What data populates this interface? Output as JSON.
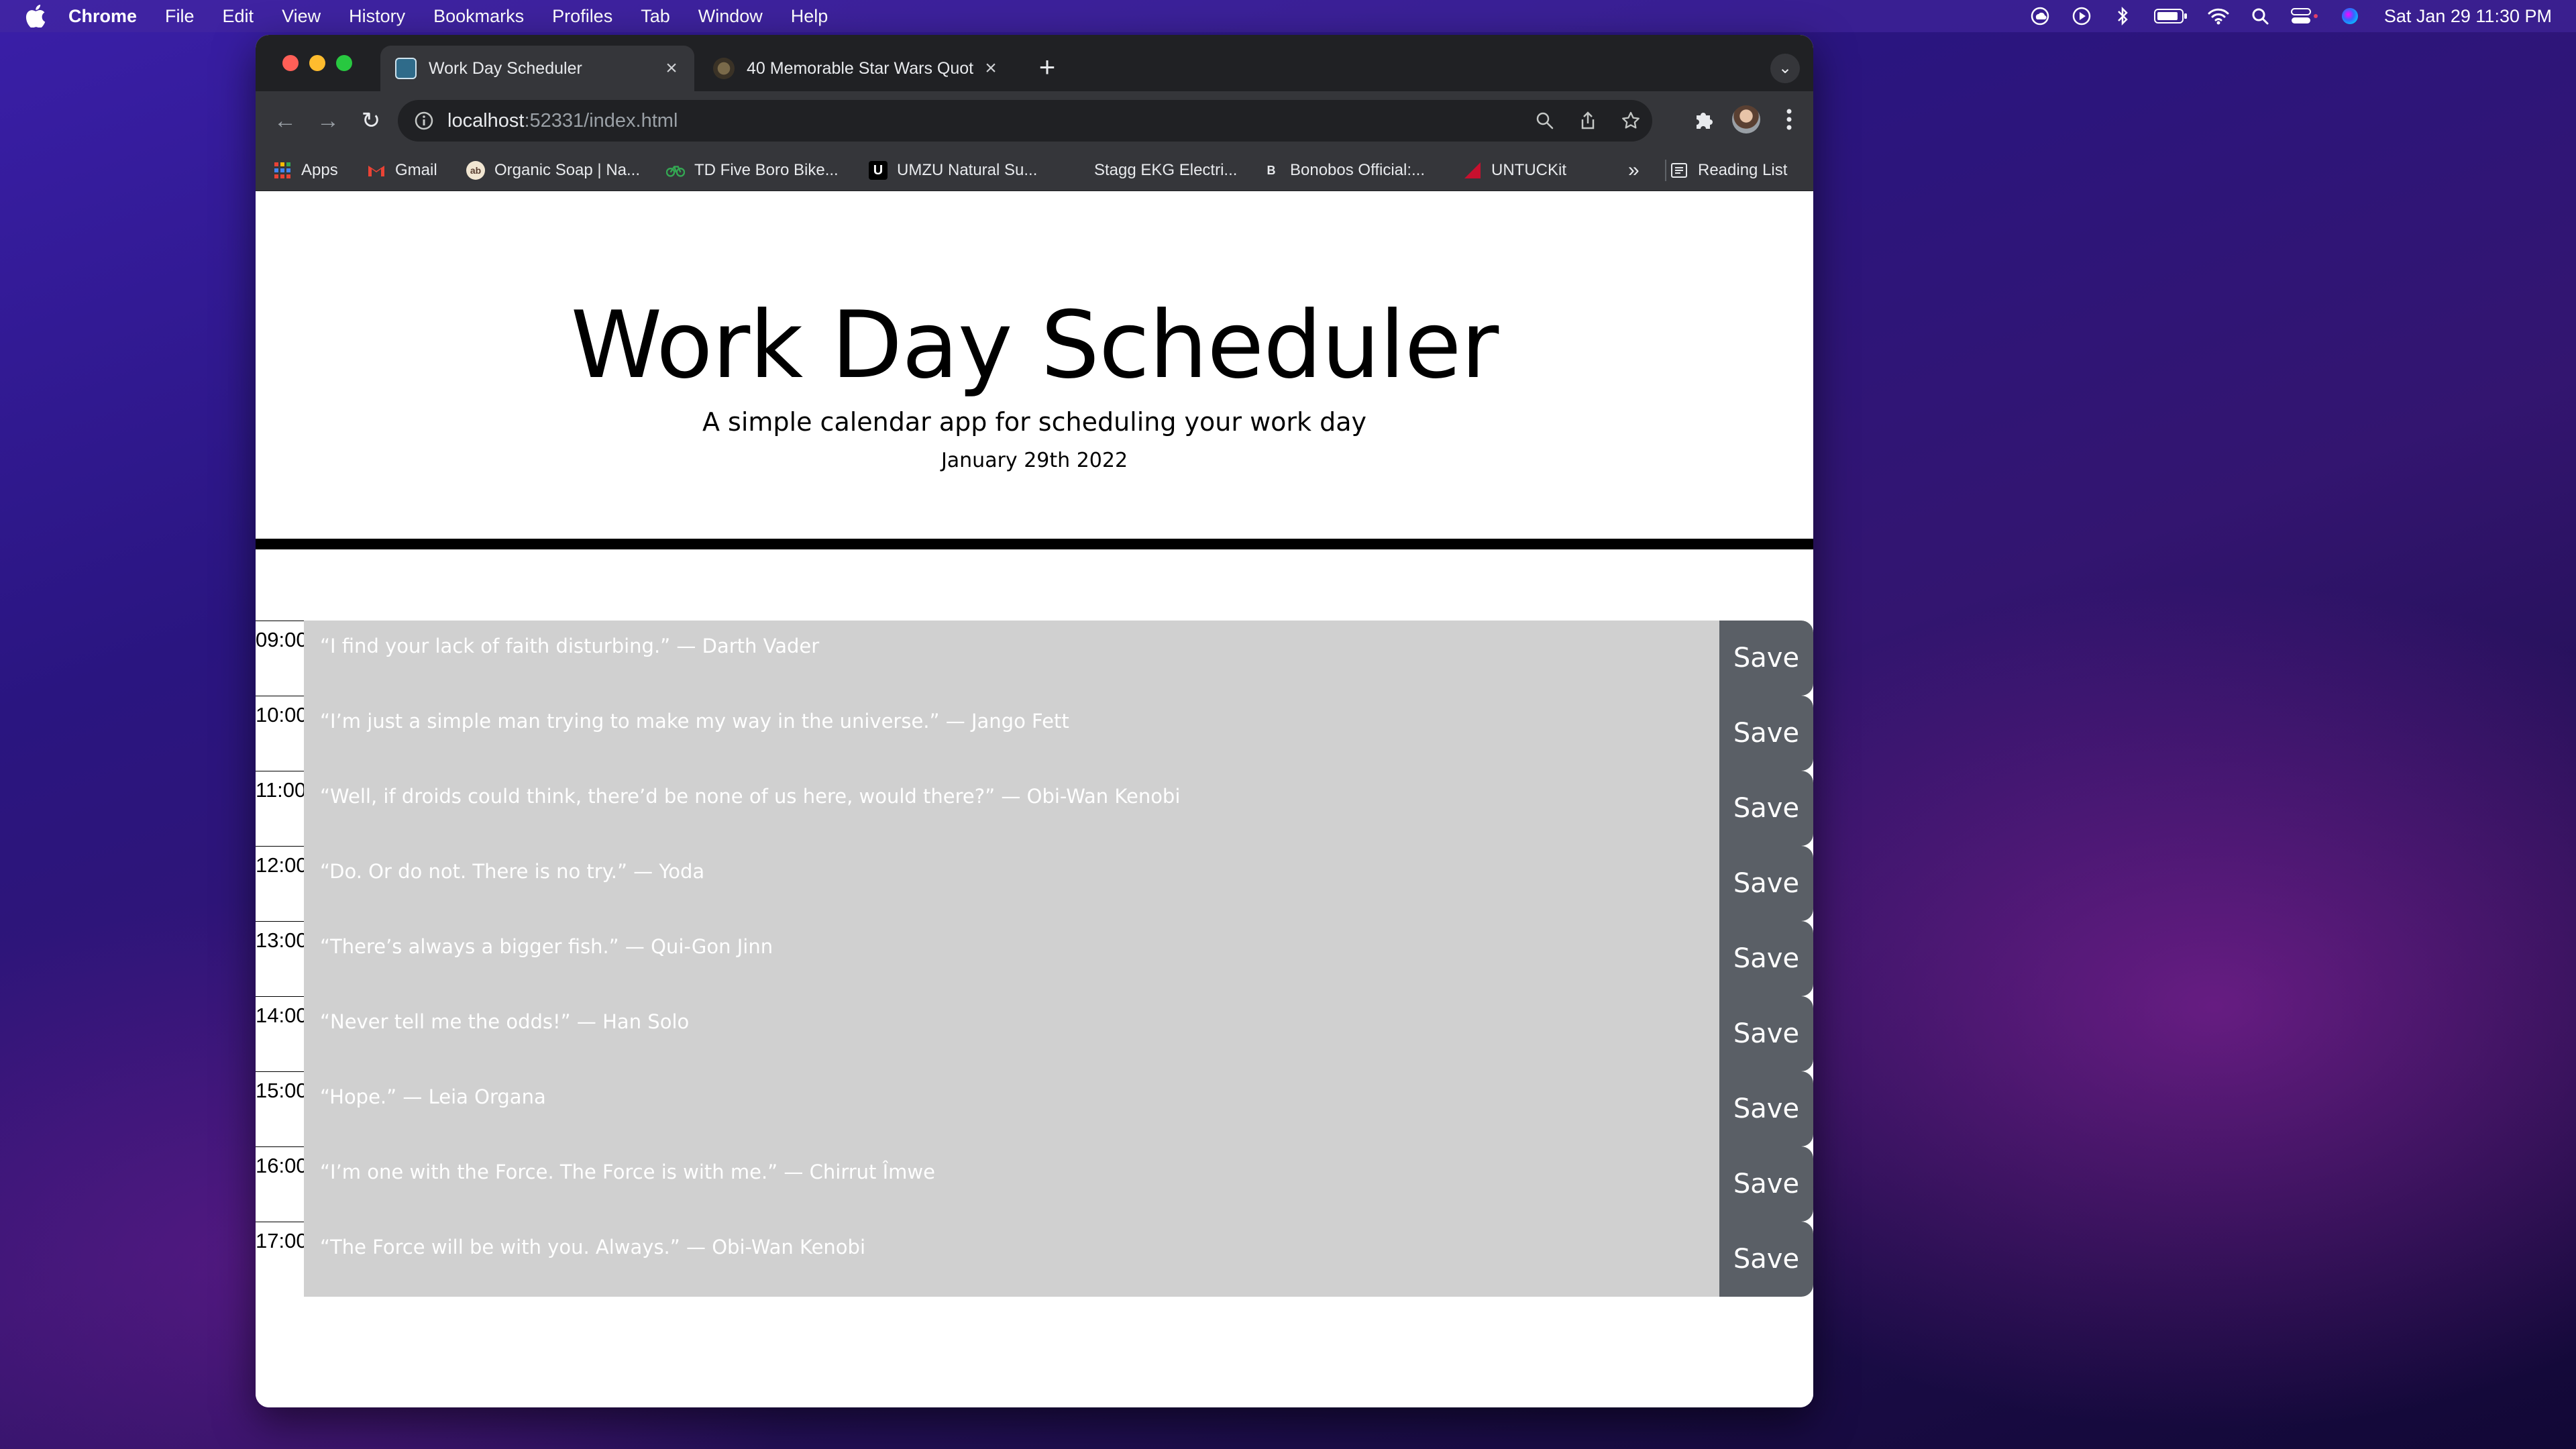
{
  "menubar": {
    "app_name": "Chrome",
    "items": [
      "File",
      "Edit",
      "View",
      "History",
      "Bookmarks",
      "Profiles",
      "Tab",
      "Window",
      "Help"
    ],
    "clock": "Sat Jan 29  11:30 PM",
    "status_icons": [
      "cloud-sync-icon",
      "play-icon",
      "bluetooth-icon",
      "battery-icon",
      "wifi-icon",
      "spotlight-search-icon",
      "control-center-icon",
      "siri-icon"
    ]
  },
  "browser": {
    "tabs": [
      {
        "title": "Work Day Scheduler",
        "active": true
      },
      {
        "title": "40 Memorable Star Wars Quot",
        "active": false
      }
    ],
    "url": {
      "host": "localhost",
      "path": ":52331/index.html"
    },
    "bookmarks": [
      {
        "label": "Apps",
        "icon": "apps-grid-icon"
      },
      {
        "label": "Gmail",
        "icon": "gmail-icon"
      },
      {
        "label": "Organic Soap | Na...",
        "icon": "soap-icon"
      },
      {
        "label": "TD Five Boro Bike...",
        "icon": "bike-icon"
      },
      {
        "label": "UMZU Natural Su...",
        "icon": "umzu-icon"
      },
      {
        "label": "Stagg EKG Electri...",
        "icon": "kettle-icon"
      },
      {
        "label": "Bonobos Official:...",
        "icon": "bonobos-icon"
      },
      {
        "label": "UNTUCKit",
        "icon": "untuckit-icon"
      }
    ],
    "overflow_label": "»",
    "reading_list": "Reading List"
  },
  "page": {
    "title": "Work Day Scheduler",
    "lead": "A simple calendar app for scheduling your work day",
    "date": "January 29th 2022",
    "save_label": "Save",
    "rows": [
      {
        "hour": "09:00",
        "text": "“I find your lack of faith disturbing.” — Darth Vader"
      },
      {
        "hour": "10:00",
        "text": "“I’m just a simple man trying to make my way in the universe.” — Jango Fett"
      },
      {
        "hour": "11:00",
        "text": "“Well, if droids could think, there’d be none of us here, would there?” — Obi-Wan Kenobi"
      },
      {
        "hour": "12:00",
        "text": "“Do. Or do not. There is no try.” — Yoda"
      },
      {
        "hour": "13:00",
        "text": "“There’s always a bigger fish.” — Qui-Gon Jinn"
      },
      {
        "hour": "14:00",
        "text": "“Never tell me the odds!” — Han Solo"
      },
      {
        "hour": "15:00",
        "text": "“Hope.” — Leia Organa"
      },
      {
        "hour": "16:00",
        "text": "“I’m one with the Force. The Force is with me.” — Chirrut Îmwe"
      },
      {
        "hour": "17:00",
        "text": "“The Force will be with you. Always.” — Obi-Wan Kenobi"
      }
    ]
  },
  "colors": {
    "row_bg": "#d0d0d0",
    "save_bg": "#5a5f66",
    "chrome_dark": "#202124",
    "chrome_toolbar": "#35363a"
  }
}
